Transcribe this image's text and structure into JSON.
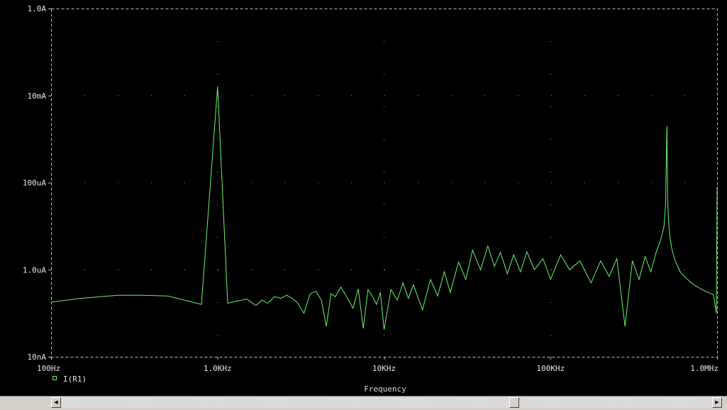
{
  "chart_data": {
    "type": "line",
    "xlabel": "Frequency",
    "ylabel": "",
    "xscale": "log",
    "yscale": "log",
    "xlim": [
      100,
      1000000
    ],
    "ylim": [
      1e-08,
      1
    ],
    "grid": "dotted",
    "legend_position": "bottom-left",
    "x_ticks": [
      {
        "value": 100,
        "label": "100Hz"
      },
      {
        "value": 1000,
        "label": "1.0KHz"
      },
      {
        "value": 10000,
        "label": "10KHz"
      },
      {
        "value": 100000,
        "label": "100KHz"
      },
      {
        "value": 1000000,
        "label": "1.0MHz"
      }
    ],
    "y_ticks": [
      {
        "value": 1e-08,
        "label": "10nA"
      },
      {
        "value": 1e-06,
        "label": "1.0uA"
      },
      {
        "value": 0.0001,
        "label": "100uA"
      },
      {
        "value": 0.01,
        "label": "10mA"
      },
      {
        "value": 1,
        "label": "1.0A"
      }
    ],
    "series": [
      {
        "name": "I(R1)",
        "color": "#66f566",
        "x": [
          100,
          150,
          250,
          350,
          500,
          800,
          1000,
          1150,
          1300,
          1500,
          1700,
          1850,
          2000,
          2200,
          2400,
          2600,
          2800,
          3000,
          3300,
          3600,
          3900,
          4200,
          4500,
          4800,
          5100,
          5500,
          6000,
          6500,
          7000,
          7500,
          8000,
          8500,
          9000,
          9500,
          10000,
          11000,
          12000,
          13000,
          14000,
          15000,
          17000,
          19000,
          21000,
          23000,
          25000,
          28000,
          31000,
          34000,
          38000,
          42000,
          46000,
          50000,
          55000,
          60000,
          66000,
          72000,
          80000,
          90000,
          100000,
          115000,
          130000,
          150000,
          175000,
          200000,
          225000,
          250000,
          280000,
          310000,
          340000,
          370000,
          400000,
          430000,
          460000,
          480000,
          490000,
          500000,
          505000,
          510000,
          520000,
          535000,
          560000,
          600000,
          650000,
          700000,
          750000,
          800000,
          850000,
          900000,
          950000,
          990000,
          1000000
        ],
        "y": [
          1.8e-07,
          2.2e-07,
          2.6e-07,
          2.6e-07,
          2.5e-07,
          1.6e-07,
          0.016,
          1.7e-07,
          1.9e-07,
          2.1e-07,
          1.5e-07,
          2e-07,
          1.7e-07,
          2.4e-07,
          2.2e-07,
          2.6e-07,
          2.2e-07,
          1.8e-07,
          1e-07,
          2.8e-07,
          3.2e-07,
          2e-07,
          5e-08,
          2.8e-07,
          2.4e-07,
          4e-07,
          2.3e-07,
          1.3e-07,
          3.6e-07,
          4.5e-08,
          3.5e-07,
          2.5e-07,
          1.6e-07,
          3e-07,
          4.2e-08,
          3.5e-07,
          2e-07,
          5e-07,
          2.2e-07,
          4.5e-07,
          1.2e-07,
          6e-07,
          2.5e-07,
          9e-07,
          3e-07,
          1.5e-06,
          6e-07,
          2.8e-06,
          1e-06,
          3.5e-06,
          1.2e-06,
          2.5e-06,
          8e-07,
          2.2e-06,
          9e-07,
          2.6e-06,
          1e-06,
          1.8e-06,
          6e-07,
          2.2e-06,
          1e-06,
          1.6e-06,
          5e-07,
          1.6e-06,
          7e-07,
          1.8e-06,
          5e-08,
          1.6e-06,
          6e-07,
          2e-06,
          9e-07,
          2.5e-06,
          5e-06,
          1e-05,
          3e-05,
          0.002,
          4e-05,
          1.5e-05,
          6e-06,
          3e-06,
          1.6e-06,
          9e-07,
          6.5e-07,
          5e-07,
          4.2e-07,
          3.6e-07,
          3.2e-07,
          2.9e-07,
          2.7e-07,
          1e-07,
          8e-05
        ]
      }
    ]
  }
}
